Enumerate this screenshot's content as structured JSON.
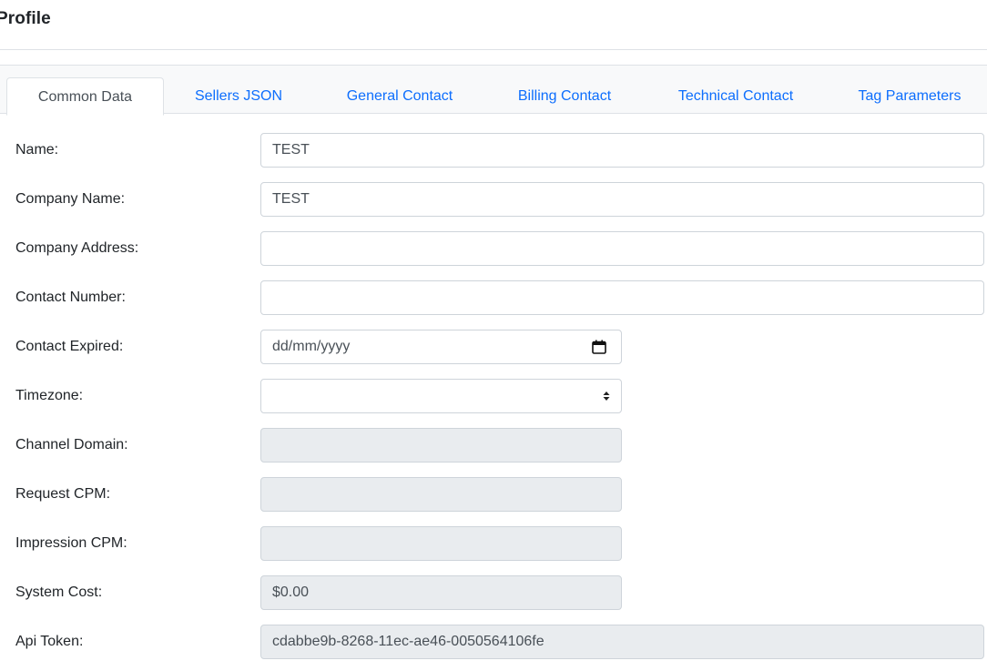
{
  "page": {
    "title": "Profile"
  },
  "tabs": [
    {
      "label": "Common Data",
      "active": true
    },
    {
      "label": "Sellers JSON",
      "active": false
    },
    {
      "label": "General Contact",
      "active": false
    },
    {
      "label": "Billing Contact",
      "active": false
    },
    {
      "label": "Technical Contact",
      "active": false
    },
    {
      "label": "Tag Parameters",
      "active": false
    }
  ],
  "form": {
    "name": {
      "label": "Name:",
      "value": "TEST"
    },
    "company_name": {
      "label": "Company Name:",
      "value": "TEST"
    },
    "company_address": {
      "label": "Company Address:",
      "value": ""
    },
    "contact_number": {
      "label": "Contact Number:",
      "value": ""
    },
    "contact_expired": {
      "label": "Contact Expired:",
      "placeholder": "dd/mm/yyyy",
      "icon": "calendar-icon"
    },
    "timezone": {
      "label": "Timezone:",
      "value": "",
      "icon": "select-arrows-icon"
    },
    "channel_domain": {
      "label": "Channel Domain:",
      "value": ""
    },
    "request_cpm": {
      "label": "Request CPM:",
      "value": ""
    },
    "impression_cpm": {
      "label": "Impression CPM:",
      "value": ""
    },
    "system_cost": {
      "label": "System Cost:",
      "value": "$0.00"
    },
    "api_token": {
      "label": "Api Token:",
      "value": "cdabbe9b-8268-11ec-ae46-0050564106fe"
    }
  },
  "colors": {
    "link": "#0d6efd",
    "disabled_bg": "#e9ecef",
    "border": "#ced4da"
  }
}
